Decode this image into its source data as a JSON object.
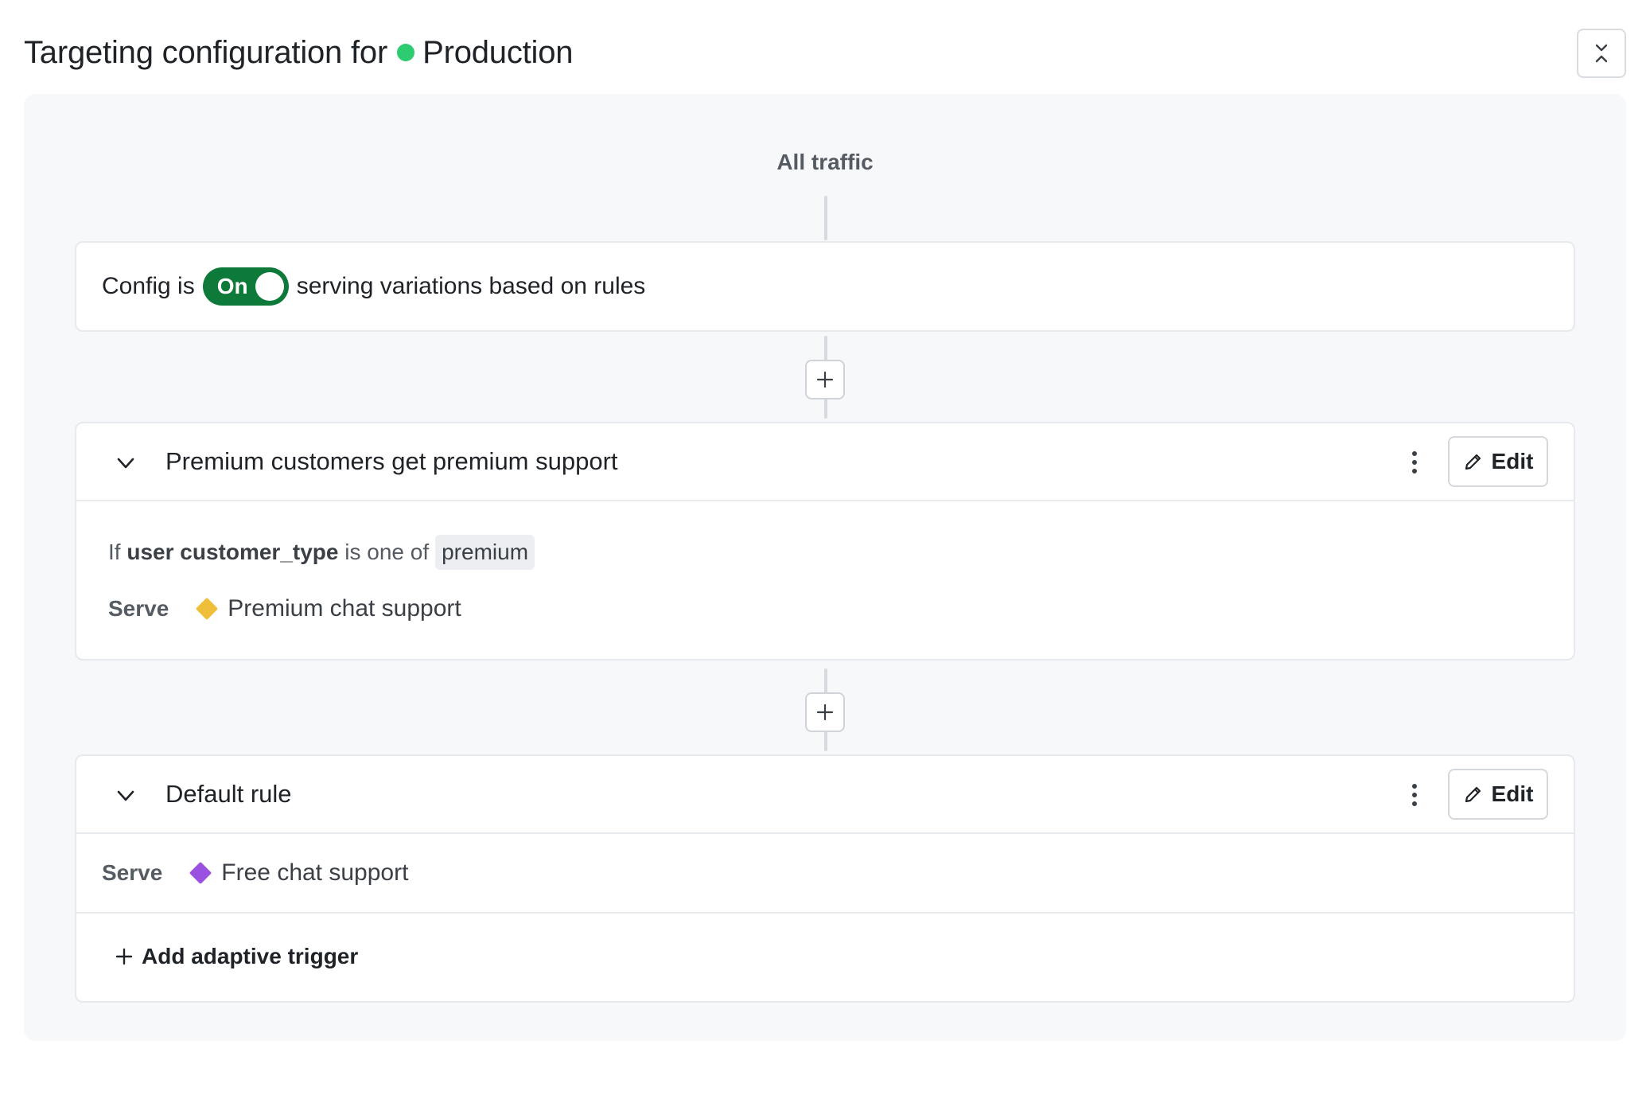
{
  "header": {
    "title_prefix": "Targeting configuration for",
    "environment": "Production",
    "environment_color": "#2ecc71",
    "collapse_icon": "collapse-vertical-icon"
  },
  "flow": {
    "all_traffic_label": "All traffic"
  },
  "config": {
    "prefix": "Config is",
    "toggle_label": "On",
    "toggle_state": "on",
    "toggle_color": "#0e7a3a",
    "suffix": "serving variations based on rules"
  },
  "rules": [
    {
      "title": "Premium customers get premium support",
      "edit_label": "Edit",
      "condition": {
        "if": "If",
        "context": "user",
        "attribute": "customer_type",
        "operator": "is one of",
        "values": [
          "premium"
        ]
      },
      "serve_label": "Serve",
      "variation": "Premium chat support",
      "variation_color": "#f0bf3a"
    }
  ],
  "default_rule": {
    "title": "Default rule",
    "edit_label": "Edit",
    "serve_label": "Serve",
    "variation": "Free chat support",
    "variation_color": "#9b51e0",
    "add_trigger_label": "Add adaptive trigger"
  }
}
